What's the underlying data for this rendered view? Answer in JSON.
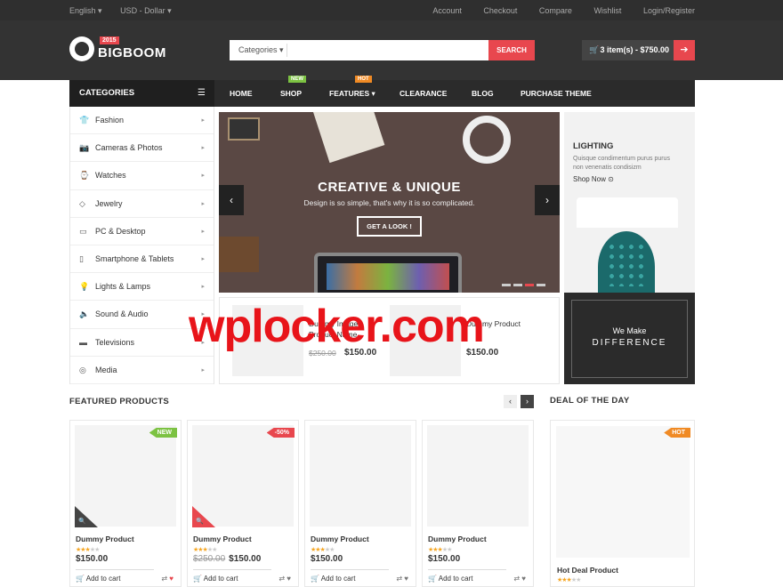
{
  "topbar": {
    "language": "English ▾",
    "currency": "USD - Dollar ▾",
    "links": [
      "Account",
      "Checkout",
      "Compare",
      "Wishlist",
      "Login/Register"
    ]
  },
  "header": {
    "logo_text": "BIGBOOM",
    "logo_year": "2015",
    "search_category": "Categories ▾",
    "search_button": "SEARCH",
    "cart_label": "3 item(s) - $750.00",
    "cart_go": "➔"
  },
  "nav": {
    "categories_label": "CATEGORIES",
    "items": [
      {
        "label": "HOME",
        "badge": ""
      },
      {
        "label": "SHOP",
        "badge": "NEW"
      },
      {
        "label": "FEATURES ▾",
        "badge": "HOT"
      },
      {
        "label": "CLEARANCE",
        "badge": ""
      },
      {
        "label": "BLOG",
        "badge": ""
      },
      {
        "label": "PURCHASE THEME",
        "badge": ""
      }
    ],
    "badge_colors": {
      "NEW": "#7cc242",
      "HOT": "#f08a24"
    }
  },
  "sidebar": {
    "items": [
      {
        "label": "Fashion",
        "icon": "shirt-icon"
      },
      {
        "label": "Cameras & Photos",
        "icon": "camera-icon"
      },
      {
        "label": "Watches",
        "icon": "watch-icon"
      },
      {
        "label": "Jewelry",
        "icon": "diamond-icon"
      },
      {
        "label": "PC & Desktop",
        "icon": "monitor-icon"
      },
      {
        "label": "Smartphone & Tablets",
        "icon": "phone-icon"
      },
      {
        "label": "Lights & Lamps",
        "icon": "bulb-icon"
      },
      {
        "label": "Sound & Audio",
        "icon": "speaker-icon"
      },
      {
        "label": "Televisions",
        "icon": "tv-icon"
      },
      {
        "label": "Media",
        "icon": "media-icon"
      }
    ]
  },
  "slider": {
    "title": "CREATIVE & UNIQUE",
    "subtitle": "Design is so simple, that's why it is so complicated.",
    "button": "GET A LOOK !",
    "prev": "‹",
    "next": "›"
  },
  "lighting": {
    "title": "LIGHTING",
    "text": "Quisque condimentum purus purus non venenatis condisizm",
    "link": "Shop Now ⊙"
  },
  "difference": {
    "line1": "We Make",
    "line2": "DIFFERENCE"
  },
  "minis": [
    {
      "name": "Dummy Image Product Name",
      "old": "$250.00",
      "price": "$150.00"
    },
    {
      "name": "Dummy Product",
      "old": "",
      "price": "$150.00"
    }
  ],
  "watermark": "wplocker.com",
  "featured": {
    "title": "FEATURED PRODUCTS",
    "prev": "‹",
    "next": "›",
    "products": [
      {
        "name": "Dummy Product",
        "stars": 3,
        "old": "",
        "price": "$150.00",
        "add": "Add to cart",
        "tag": "NEW",
        "tag_color": "#7cc242",
        "zoom": "🔍",
        "zoom_color": "#444"
      },
      {
        "name": "Dummy Product",
        "stars": 3,
        "old": "$250.00",
        "price": "$150.00",
        "add": "Add to cart",
        "tag": "-50%",
        "tag_color": "#e8474e",
        "zoom": "🔍",
        "zoom_color": "#e8474e"
      },
      {
        "name": "Dummy Product",
        "stars": 3,
        "old": "",
        "price": "$150.00",
        "add": "Add to cart",
        "tag": "",
        "tag_color": "",
        "zoom": "",
        "zoom_color": ""
      },
      {
        "name": "Dummy Product",
        "stars": 3,
        "old": "",
        "price": "$150.00",
        "add": "Add to cart",
        "tag": "",
        "tag_color": "",
        "zoom": "",
        "zoom_color": ""
      }
    ]
  },
  "deal": {
    "title": "DEAL OF THE DAY",
    "name": "Hot Deal Product",
    "stars": 3,
    "tag": "HOT",
    "tag_color": "#f08a24"
  }
}
